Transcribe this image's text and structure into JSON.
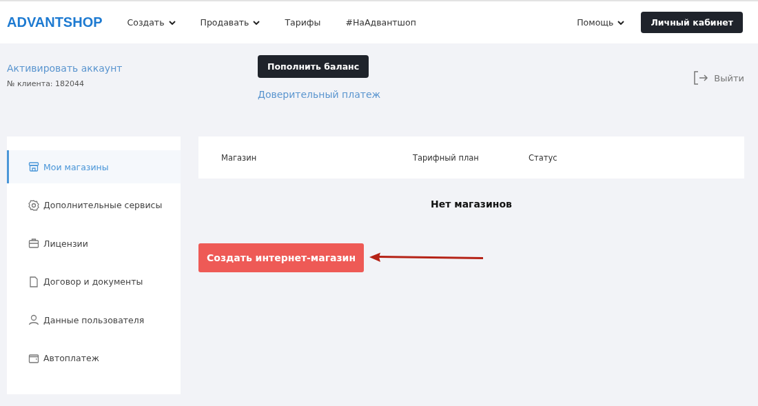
{
  "header": {
    "logo": "ADVANTSHOP",
    "nav": [
      {
        "label": "Создать",
        "kind": "dropdown"
      },
      {
        "label": "Продавать",
        "kind": "dropdown"
      },
      {
        "label": "Тарифы",
        "kind": "link"
      },
      {
        "label": "#НаАдвантшоп",
        "kind": "link"
      }
    ],
    "help": {
      "label": "Помощь",
      "kind": "dropdown"
    },
    "account_button": "Личный кабинет"
  },
  "account": {
    "activate_link": "Активировать аккаунт",
    "client_number": "№ клиента: 182044",
    "topup_button": "Пополнить баланс",
    "trust_payment_link": "Доверительный платеж",
    "logout": "Выйти"
  },
  "sidebar": {
    "items": [
      {
        "label": "Мои магазины",
        "selected": true
      },
      {
        "label": "Дополнительные сервисы",
        "selected": false
      },
      {
        "label": "Лицензии",
        "selected": false
      },
      {
        "label": "Договор и документы",
        "selected": false
      },
      {
        "label": "Данные пользователя",
        "selected": false
      },
      {
        "label": "Автоплатеж",
        "selected": false
      }
    ]
  },
  "table": {
    "columns": [
      "Магазин",
      "Тарифный план",
      "Статус"
    ],
    "empty_message": "Нет магазинов"
  },
  "create_button": "Создать интернет-магазин"
}
